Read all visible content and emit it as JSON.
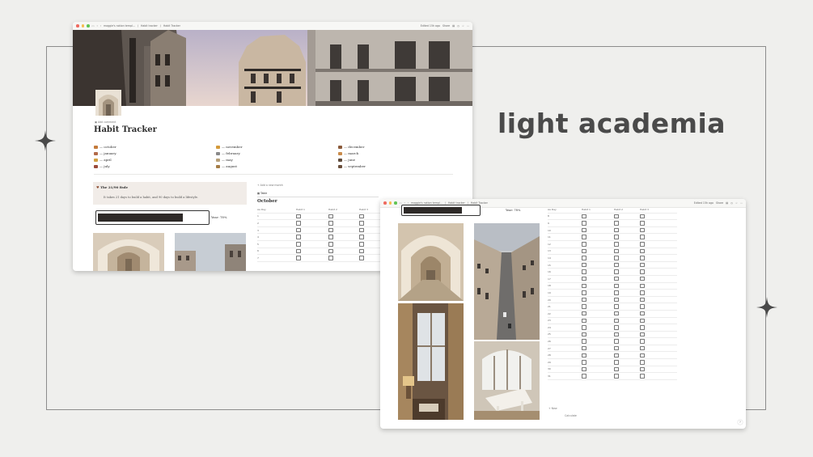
{
  "brand": {
    "title": "light academia"
  },
  "window1": {
    "breadcrumb": [
      "maggie's notion templ...",
      "Habit tracker",
      "Habit Tracker"
    ],
    "edited": "Edited 15h ago",
    "share": "Share",
    "add_comment": "Add comment",
    "page_title": "Habit Tracker",
    "months": [
      [
        "— october",
        "— november",
        "— december"
      ],
      [
        "— january",
        "— february",
        "— march"
      ],
      [
        "— april",
        "— may",
        "— june"
      ],
      [
        "— july",
        "— august",
        "— september"
      ]
    ],
    "callout": {
      "title": "The 21/90 Rule",
      "body": "It takes 21 days to build a habit, and 90 days to build a lifestyle."
    },
    "progress": {
      "label": "Year: 78%",
      "value": 0.78
    },
    "add_month": "+ Add a new month",
    "view_tab": "Table",
    "table_title": "October",
    "columns": [
      "Aa Day",
      "Habit 1",
      "Habit 2",
      "Habit 3"
    ],
    "rows": [
      "1",
      "2",
      "3",
      "4",
      "5",
      "6",
      "7"
    ]
  },
  "window2": {
    "breadcrumb": [
      "maggie's notion templ...",
      "Habit tracker",
      "Habit Tracker"
    ],
    "edited": "Edited 15h ago",
    "share": "Share",
    "progress": {
      "label": "Year: 78%",
      "value": 0.78
    },
    "columns": [
      "Aa Day",
      "Habit 1",
      "Habit 2",
      "Habit 3"
    ],
    "rows": [
      "8",
      "9",
      "10",
      "11",
      "12",
      "13",
      "14",
      "15",
      "16",
      "17",
      "18",
      "19",
      "20",
      "21",
      "22",
      "23",
      "24",
      "25",
      "26",
      "27",
      "28",
      "29",
      "30",
      "31"
    ],
    "new_row": "+ New",
    "calculate": "Calculate"
  }
}
